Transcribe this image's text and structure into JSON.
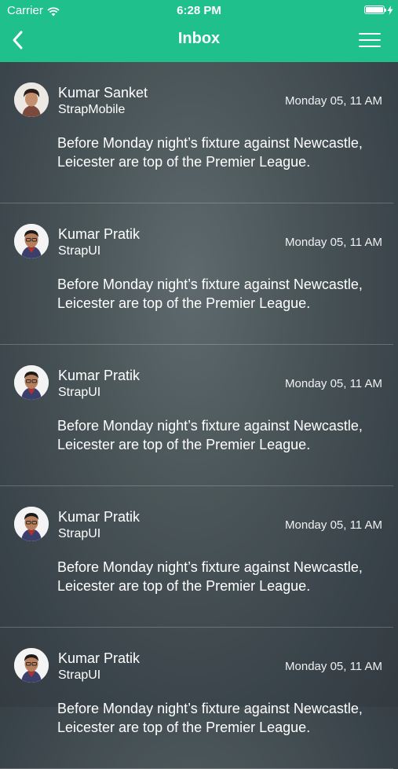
{
  "status_bar": {
    "carrier": "Carrier",
    "time": "6:28 PM"
  },
  "nav": {
    "title": "Inbox",
    "back_icon": "chevron-left-icon",
    "menu_icon": "hamburger-menu-icon"
  },
  "colors": {
    "header_green": "#1fc08c",
    "background": "#4a5558",
    "text": "#ffffff"
  },
  "messages": [
    {
      "avatar": "avatar-kumar-sanket",
      "name": "Kumar Sanket",
      "org": "StrapMobile",
      "time": "Monday 05, 11 AM",
      "body": "Before Monday night’s fixture against Newcastle, Leicester are top of the Premier League."
    },
    {
      "avatar": "avatar-kumar-pratik",
      "name": "Kumar Pratik",
      "org": "StrapUI",
      "time": "Monday 05, 11 AM",
      "body": "Before Monday night’s fixture against Newcastle, Leicester are top of the Premier League."
    },
    {
      "avatar": "avatar-kumar-pratik",
      "name": "Kumar Pratik",
      "org": "StrapUI",
      "time": "Monday 05, 11 AM",
      "body": "Before Monday night’s fixture against Newcastle, Leicester are top of the Premier League."
    },
    {
      "avatar": "avatar-kumar-pratik",
      "name": "Kumar Pratik",
      "org": "StrapUI",
      "time": "Monday 05, 11 AM",
      "body": "Before Monday night’s fixture against Newcastle, Leicester are top of the Premier League."
    },
    {
      "avatar": "avatar-kumar-pratik",
      "name": "Kumar Pratik",
      "org": "StrapUI",
      "time": "Monday 05, 11 AM",
      "body": "Before Monday night’s fixture against Newcastle, Leicester are top of the Premier League."
    }
  ]
}
